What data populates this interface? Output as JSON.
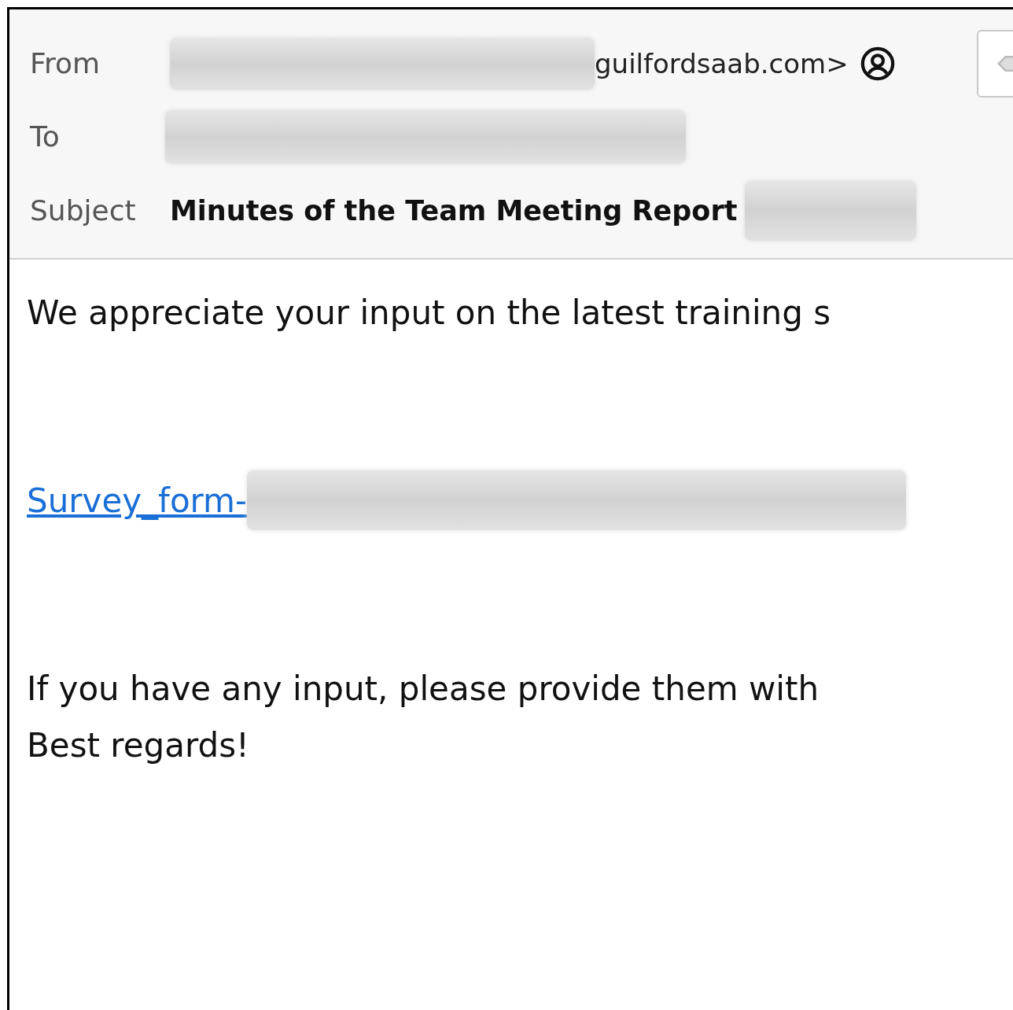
{
  "header": {
    "fields": [
      {
        "label": "From",
        "value": "guilfordsaab.com>",
        "redacted": true,
        "contact_icon": true
      },
      {
        "label": "To",
        "redacted": true
      },
      {
        "label": "Subject",
        "value": "Minutes of the Team Meeting Report",
        "redacted": true,
        "bold": true
      }
    ]
  },
  "body": {
    "blocks": [
      {
        "kind": "text",
        "text": "We appreciate your input on the latest training s"
      },
      {
        "kind": "link",
        "text": "Survey_form-",
        "redacted": true
      },
      {
        "kind": "text",
        "text": "If you have any input, please provide them with"
      },
      {
        "kind": "text",
        "text": "Best regards!"
      }
    ]
  }
}
